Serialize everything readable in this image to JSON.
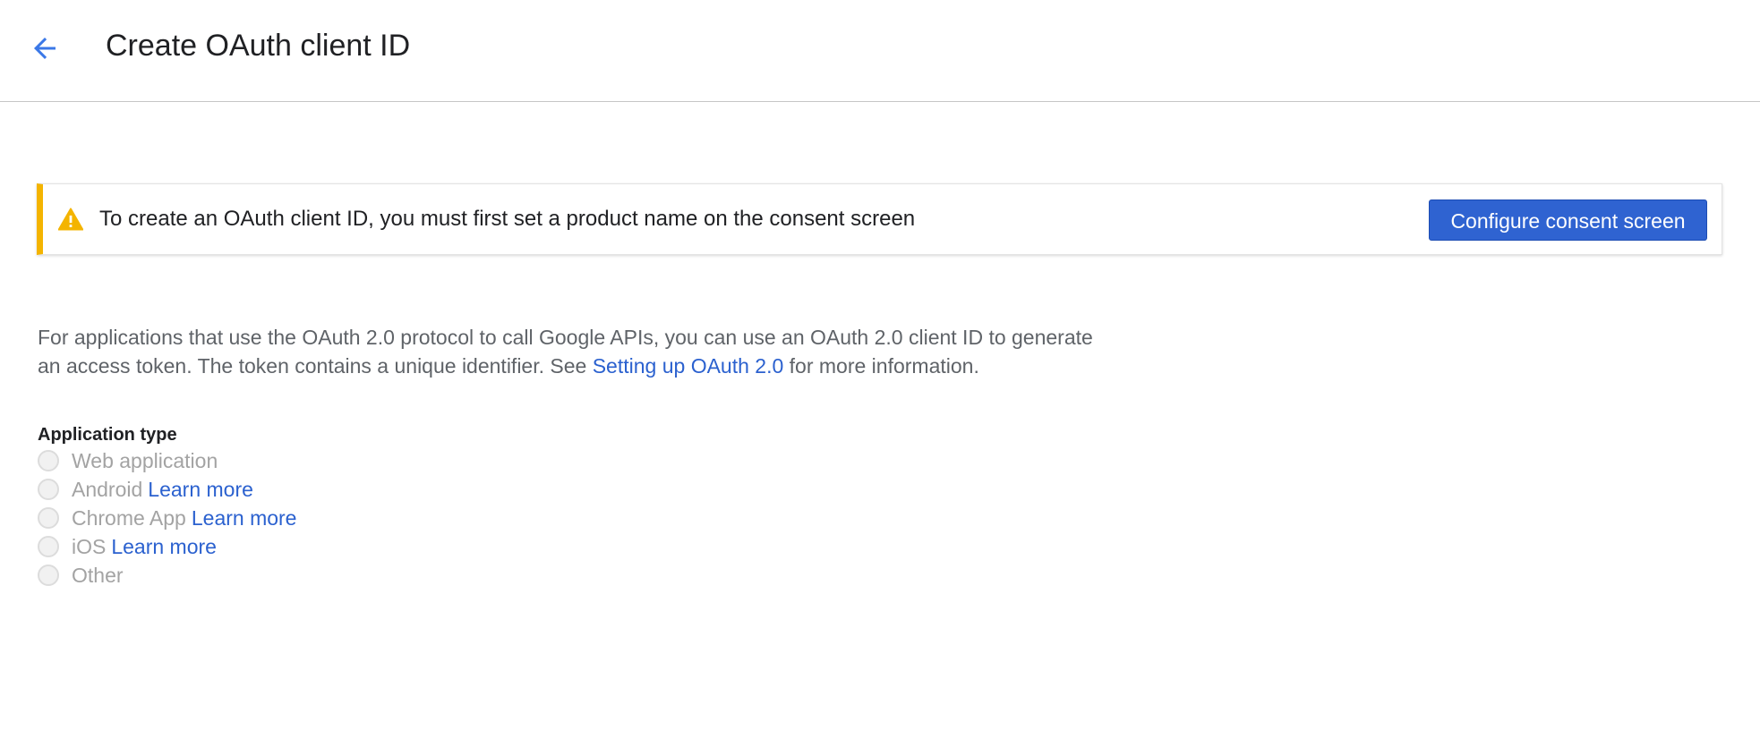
{
  "header": {
    "back_icon": "arrow-back-icon",
    "title": "Create OAuth client ID"
  },
  "warning": {
    "icon": "warning-icon",
    "text": "To create an OAuth client ID, you must first set a product name on the consent screen",
    "button_label": "Configure consent screen",
    "accent_color": "#f4b400"
  },
  "description": {
    "text_before_link": "For applications that use the OAuth 2.0 protocol to call Google APIs, you can use an OAuth 2.0 client ID to generate an access token. The token contains a unique identifier. See ",
    "link_text": "Setting up OAuth 2.0",
    "text_after_link": " for more information."
  },
  "application_type": {
    "label": "Application type",
    "options": [
      {
        "label": "Web application",
        "link": null,
        "disabled": true,
        "selected": false
      },
      {
        "label": "Android",
        "link": "Learn more",
        "disabled": true,
        "selected": false
      },
      {
        "label": "Chrome App",
        "link": "Learn more",
        "disabled": true,
        "selected": false
      },
      {
        "label": "iOS",
        "link": "Learn more",
        "disabled": true,
        "selected": false
      },
      {
        "label": "Other",
        "link": null,
        "disabled": true,
        "selected": false
      }
    ]
  },
  "colors": {
    "primary_button": "#2f63d1",
    "link": "#2b61cf",
    "back_arrow": "#3b78e7"
  }
}
